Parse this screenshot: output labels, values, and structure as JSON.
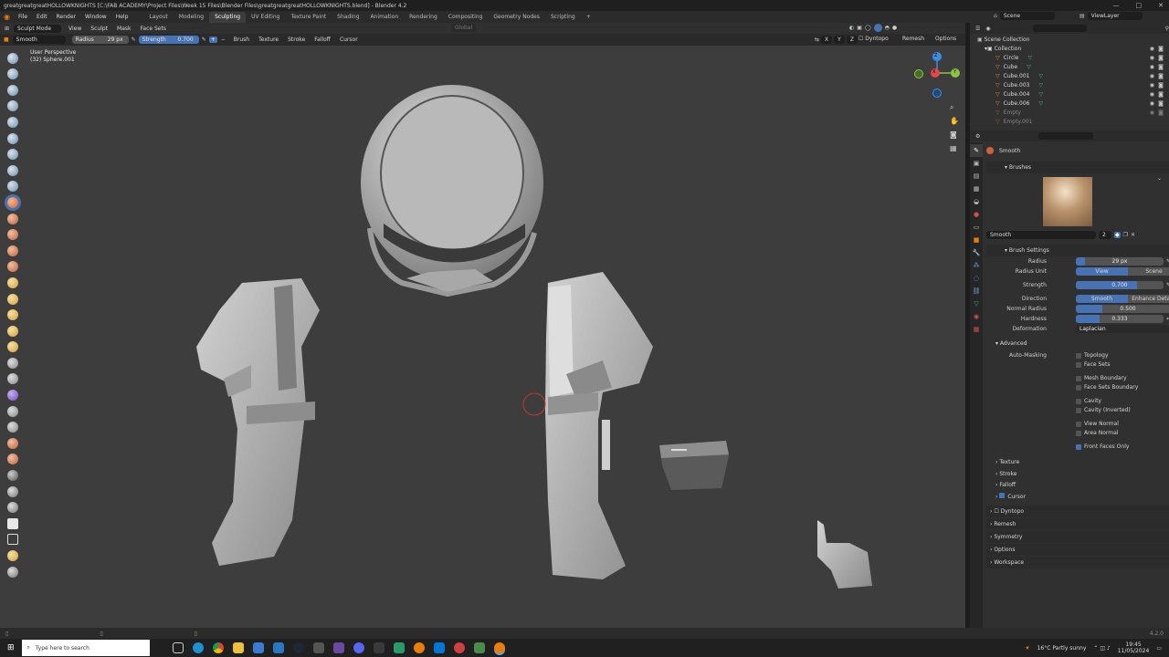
{
  "window": {
    "title": "greatgreatgreatHOLLOWKNIGHTS [C:\\FAB ACADEMY\\Project Files\\Week 15 Files\\Blender Files\\greatgreatgreatHOLLOWKNIGHTS.blend] - Blender 4.2",
    "controls": [
      "—",
      "□",
      "✕"
    ]
  },
  "menubar": {
    "menus": [
      "File",
      "Edit",
      "Render",
      "Window",
      "Help"
    ],
    "workspaces": [
      "Layout",
      "Modeling",
      "Sculpting",
      "UV Editing",
      "Texture Paint",
      "Shading",
      "Animation",
      "Rendering",
      "Compositing",
      "Geometry Nodes",
      "Scripting"
    ],
    "active_workspace": "Sculpting",
    "add_tab": "+",
    "scene": "Scene",
    "view_layer": "ViewLayer"
  },
  "header": {
    "mode": "Sculpt Mode",
    "menus": [
      "View",
      "Sculpt",
      "Mask",
      "Face Sets"
    ],
    "transform_space": "Global",
    "options": "Options",
    "dyntopo": "Dyntopo",
    "remesh": "Remesh",
    "axis_x": "X",
    "axis_y": "Y",
    "axis_z": "Z"
  },
  "tool_header": {
    "brush": "Smooth",
    "radius_label": "Radius",
    "radius_value": "29 px",
    "strength_label": "Strength",
    "strength_value": "0.700",
    "dropdowns": [
      "Brush",
      "Texture",
      "Stroke",
      "Falloff",
      "Cursor"
    ]
  },
  "viewport": {
    "perspective": "User Perspective",
    "object": "(32) Sphere.001",
    "gizmo": {
      "x": "X",
      "y": "Y",
      "z": "Z"
    }
  },
  "outliner": {
    "search_placeholder": "",
    "scene_collection": "Scene Collection",
    "collection": "Collection",
    "items": [
      "Circle",
      "Cube",
      "Cube.001",
      "Cube.003",
      "Cube.004",
      "Cube.006",
      "Empty",
      "Empty.001"
    ]
  },
  "properties": {
    "brush_name": "Smooth",
    "brushes_section": "Brushes",
    "brush_slot_name": "Smooth",
    "brush_users": "2",
    "brush_settings": "Brush Settings",
    "radius": {
      "label": "Radius",
      "value": "29 px",
      "fill": 0.1
    },
    "radius_unit": {
      "label": "Radius Unit",
      "opt1": "View",
      "opt2": "Scene"
    },
    "strength": {
      "label": "Strength",
      "value": "0.700",
      "fill": 0.7
    },
    "direction": {
      "label": "Direction",
      "opt1": "Smooth",
      "opt2": "Enhance Details"
    },
    "normal_radius": {
      "label": "Normal Radius",
      "value": "0.500",
      "fill": 0.25
    },
    "hardness": {
      "label": "Hardness",
      "value": "0.333",
      "fill": 0.27
    },
    "deformation": {
      "label": "Deformation",
      "value": "Laplacian"
    },
    "advanced": "Advanced",
    "auto_masking": "Auto-Masking",
    "checks": [
      {
        "label": "Topology",
        "on": false
      },
      {
        "label": "Face Sets",
        "on": false
      },
      {
        "label": "Mesh Boundary",
        "on": false
      },
      {
        "label": "Face Sets Boundary",
        "on": false
      },
      {
        "label": "Cavity",
        "on": false
      },
      {
        "label": "Cavity (Inverted)",
        "on": false
      },
      {
        "label": "View Normal",
        "on": false
      },
      {
        "label": "Area Normal",
        "on": false
      },
      {
        "label": "Front Faces Only",
        "on": true
      }
    ],
    "subsections": [
      "Texture",
      "Stroke",
      "Falloff",
      "Cursor"
    ],
    "panels": [
      "Dyntopo",
      "Remesh",
      "Symmetry",
      "Options",
      "Workspace"
    ]
  },
  "statusbar": {
    "version": "4.2.0"
  },
  "taskbar": {
    "search_placeholder": "Type here to search",
    "weather": "16°C  Partly sunny",
    "time": "19:45",
    "date": "11/05/2024"
  },
  "colors": {
    "accent": "#4772b3",
    "viewport_bg": "#3d3d3d",
    "panel_bg": "#303030",
    "mesh": "#b9b9b9",
    "gizmo_x": "#e5474d",
    "gizmo_y": "#8cc63f",
    "gizmo_z": "#3b8ee5"
  }
}
